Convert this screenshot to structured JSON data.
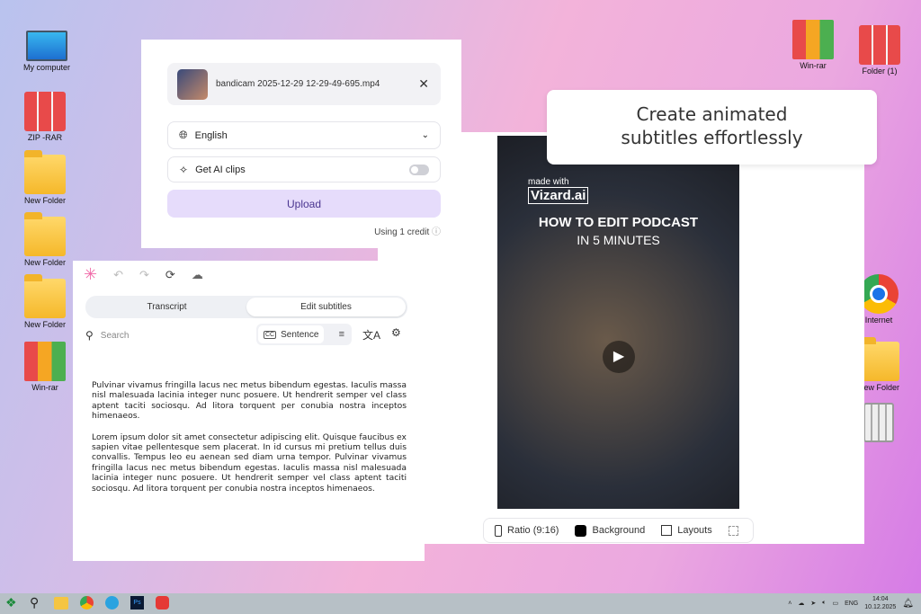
{
  "desktop": {
    "left_icons": [
      "My computer",
      "ZIP -RAR",
      "New Folder",
      "New Folder",
      "New Folder",
      "Win-rar"
    ],
    "right_icons": [
      "Win-rar",
      "Folder (1)",
      "Internet",
      "New Folder"
    ]
  },
  "upload": {
    "file_name": "bandicam 2025-12-29 12-29-49-695.mp4",
    "language": "English",
    "ai_clips_label": "Get AI clips",
    "ai_clips_on": false,
    "upload_label": "Upload",
    "credit_text": "Using 1 credit",
    "accent": "#e6dcfb"
  },
  "editor": {
    "tabs": [
      "Transcript",
      "Edit subtitles"
    ],
    "active_tab": "Edit subtitles",
    "search_placeholder": "Search",
    "sentence_label": "Sentence",
    "paragraphs": [
      "Pulvinar vivamus fringilla lacus nec metus bibendum egestas. Iaculis massa nisl malesuada lacinia integer nunc posuere. Ut hendrerit semper vel class aptent taciti sociosqu. Ad litora torquent per conubia nostra inceptos himenaeos.",
      "Lorem ipsum dolor sit amet consectetur adipiscing elit. Quisque faucibus ex sapien vitae pellentesque sem placerat. In id cursus mi pretium tellus duis convallis. Tempus leo eu aenean sed diam urna tempor. Pulvinar vivamus fringilla lacus nec metus bibendum egestas. Iaculis massa nisl malesuada lacinia integer nunc posuere. Ut hendrerit semper vel class aptent taciti sociosqu. Ad litora torquent per conubia nostra inceptos himenaeos."
    ]
  },
  "callout": {
    "line1": "Create animated",
    "line2": "subtitles effortlessly"
  },
  "video": {
    "made_with": "made with",
    "brand": "Vizard.ai",
    "title": "HOW TO EDIT PODCAST",
    "subtitle": "IN 5 MINUTES"
  },
  "preview_toolbar": {
    "ratio": "Ratio (9:16)",
    "background": "Background",
    "layouts": "Layouts"
  },
  "taskbar": {
    "lang": "ENG",
    "time": "14:04",
    "date": "10.12.2025"
  }
}
